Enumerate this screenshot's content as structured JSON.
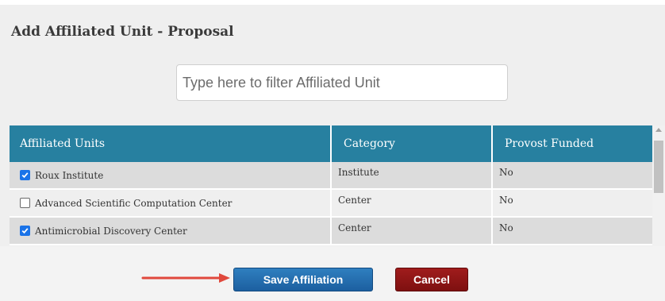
{
  "dialog": {
    "title": "Add Affiliated Unit - Proposal"
  },
  "filter": {
    "placeholder": "Type here to filter Affiliated Unit",
    "value": ""
  },
  "table": {
    "headers": {
      "unit": "Affiliated Units",
      "category": "Category",
      "provost_funded": "Provost Funded"
    },
    "rows": [
      {
        "checked": true,
        "unit": "Roux Institute",
        "category": "Institute",
        "provost_funded": "No"
      },
      {
        "checked": false,
        "unit": "Advanced Scientific Computation Center",
        "category": "Center",
        "provost_funded": "No"
      },
      {
        "checked": true,
        "unit": "Antimicrobial Discovery Center",
        "category": "Center",
        "provost_funded": "No"
      }
    ]
  },
  "buttons": {
    "save_label": "Save Affiliation",
    "cancel_label": "Cancel"
  },
  "colors": {
    "header_bg": "#2780a0",
    "save_bg": "#1c5fa0",
    "cancel_bg": "#8c1414",
    "annotation_arrow": "#e0483c",
    "checkbox_checked": "#1a73e8"
  },
  "icons": {
    "checked": "checkbox-checked-icon",
    "unchecked": "checkbox-unchecked-icon",
    "arrow": "annotation-arrow-icon",
    "scroll_up": "scroll-up-icon"
  }
}
